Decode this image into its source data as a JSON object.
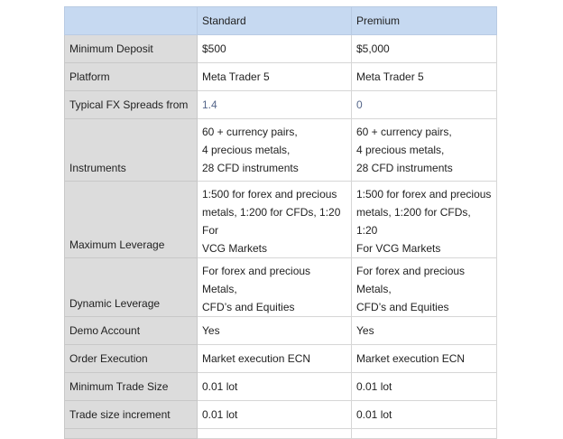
{
  "columns": {
    "corner": "",
    "standard": "Standard",
    "premium": "Premium"
  },
  "rows": [
    {
      "label": "Minimum Deposit",
      "standard": [
        "$500"
      ],
      "premium": [
        "$5,000"
      ]
    },
    {
      "label": "Platform",
      "standard": [
        "Meta Trader 5"
      ],
      "premium": [
        "Meta Trader 5"
      ]
    },
    {
      "label": "Typical FX Spreads from",
      "standard": [
        "1.4"
      ],
      "premium": [
        "0"
      ]
    },
    {
      "label": "Instruments",
      "standard": [
        "60 + currency pairs,",
        "4 precious metals,",
        "28 CFD instruments"
      ],
      "premium": [
        "60 + currency pairs,",
        "4 precious metals,",
        "28 CFD instruments"
      ]
    },
    {
      "label": "Maximum Leverage",
      "standard": [
        "1:500 for forex and precious",
        "metals, 1:200 for CFDs, 1:20 For",
        "VCG Markets"
      ],
      "premium": [
        "1:500 for forex and precious",
        "metals, 1:200 for CFDs, 1:20",
        "For VCG Markets"
      ]
    },
    {
      "label": "Dynamic Leverage",
      "standard": [
        "For forex and precious Metals,",
        "CFD’s and Equities"
      ],
      "premium": [
        "For forex and precious Metals,",
        "CFD’s and Equities"
      ]
    },
    {
      "label": "Demo Account",
      "standard": [
        "Yes"
      ],
      "premium": [
        "Yes"
      ]
    },
    {
      "label": "Order Execution",
      "standard": [
        "Market execution ECN"
      ],
      "premium": [
        "Market execution ECN"
      ]
    },
    {
      "label": "Minimum Trade Size",
      "standard": [
        "0.01 lot"
      ],
      "premium": [
        "0.01 lot"
      ]
    },
    {
      "label": "Trade size increment",
      "standard": [
        "0.01 lot"
      ],
      "premium": [
        "0.01 lot"
      ]
    }
  ]
}
